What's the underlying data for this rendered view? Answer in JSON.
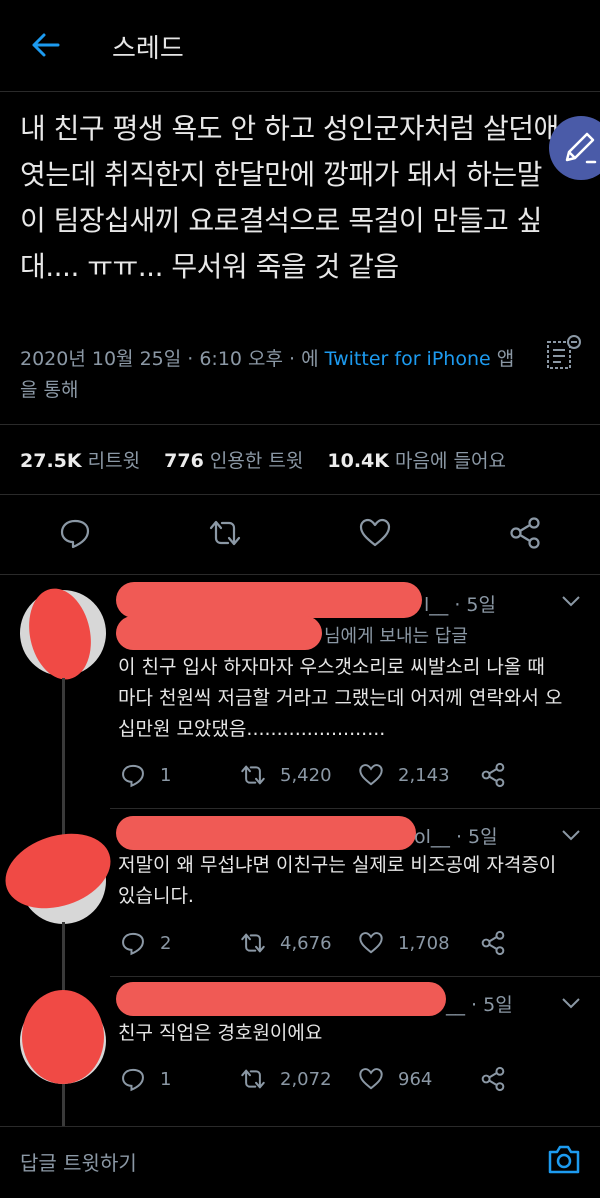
{
  "header": {
    "title": "스레드"
  },
  "tweet": {
    "text": "내 친구 평생 욕도 안 하고 성인군자처럼 살던애엿는데 취직한지 한달만에 깡패가 돼서 하는말이 팀장십새끼 요로결석으로 목걸이 만들고 싶대.... ㅠㅠ... 무서워 죽을 것 같음",
    "meta_prefix": "2020년 10월 25일 · 6:10 오후 · 에 ",
    "meta_link": "Twitter for iPhone",
    "meta_suffix": " 앱을 통해",
    "stats": {
      "retweets_count": "27.5K",
      "retweets_label": "리트윗",
      "quotes_count": "776",
      "quotes_label": "인용한 트윗",
      "likes_count": "10.4K",
      "likes_label": "마음에 들어요"
    }
  },
  "replies": [
    {
      "handle_tail": "l__ · 5일",
      "to_line": "님에게 보내는 답글",
      "text": "이 친구 입사 하자마자 우스갯소리로 씨발소리 나올 때 마다 천원씩 저금할 거라고 그랬는데 어저께 연락와서 오십만원 모았댔음.......................",
      "replies": "1",
      "retweets": "5,420",
      "likes": "2,143"
    },
    {
      "handle_tail": "ol__ · 5일",
      "text": "저말이 왜 무섭냐면 이친구는 실제로 비즈공예 자격증이 있습니다.",
      "replies": "2",
      "retweets": "4,676",
      "likes": "1,708"
    },
    {
      "handle_tail": "__ · 5일",
      "text": "친구 직업은 경호원이에요",
      "replies": "1",
      "retweets": "2,072",
      "likes": "964"
    }
  ],
  "composer": {
    "placeholder": "답글 트윗하기"
  },
  "icons": {
    "back": "arrow-left-icon",
    "compose": "pen-icon",
    "analytics": "analytics-icon",
    "reply": "speech-bubble-icon",
    "retweet": "retweet-icon",
    "like": "heart-icon",
    "share": "share-icon",
    "camera": "camera-icon",
    "caret": "chevron-down-icon"
  },
  "colors": {
    "accent": "#1d9bf0",
    "background": "#000000",
    "muted": "#8b98a5",
    "redaction": "#f04a45",
    "fab": "#4a5ba8"
  }
}
